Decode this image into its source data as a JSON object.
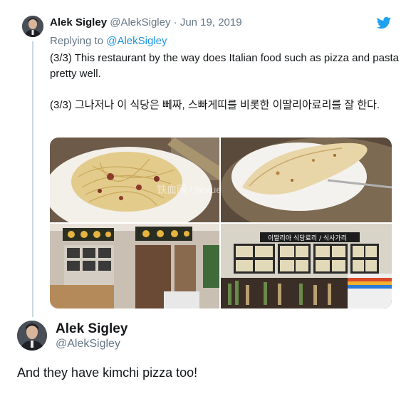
{
  "tweet": {
    "author_name": "Alek Sigley",
    "author_handle": "@AlekSigley",
    "separator": " · ",
    "date": "Jun 19, 2019",
    "replying_prefix": "Replying to ",
    "replying_to": "@AlekSigley",
    "text_en": "(3/3) This restaurant by the way does Italian food such as pizza and pasta pretty well.",
    "text_ko": "(3/3) 그나저나 이 식당은 뻬짜, 스빠게띠를 비롯한 이딸리아료리를 잘 한다.",
    "images": [
      {
        "icon": "spaghetti-photo",
        "watermark": "铁血网 / tiexue.net"
      },
      {
        "icon": "pizza-photo"
      },
      {
        "icon": "restaurant-interior-photo"
      },
      {
        "icon": "menu-board-photo",
        "sign": "이딸리아 식당료리 / 식사가리"
      }
    ]
  },
  "quote": {
    "author_name": "Alek Sigley",
    "author_handle": "@AlekSigley",
    "text": "And they have kimchi pizza too!"
  },
  "colors": {
    "brand": "#1da1f2",
    "link": "#1b95e0",
    "muted": "#657786",
    "text": "#14171a",
    "thread_line": "#ccd6dd"
  },
  "icons": {
    "bird": "twitter-bird-icon"
  }
}
